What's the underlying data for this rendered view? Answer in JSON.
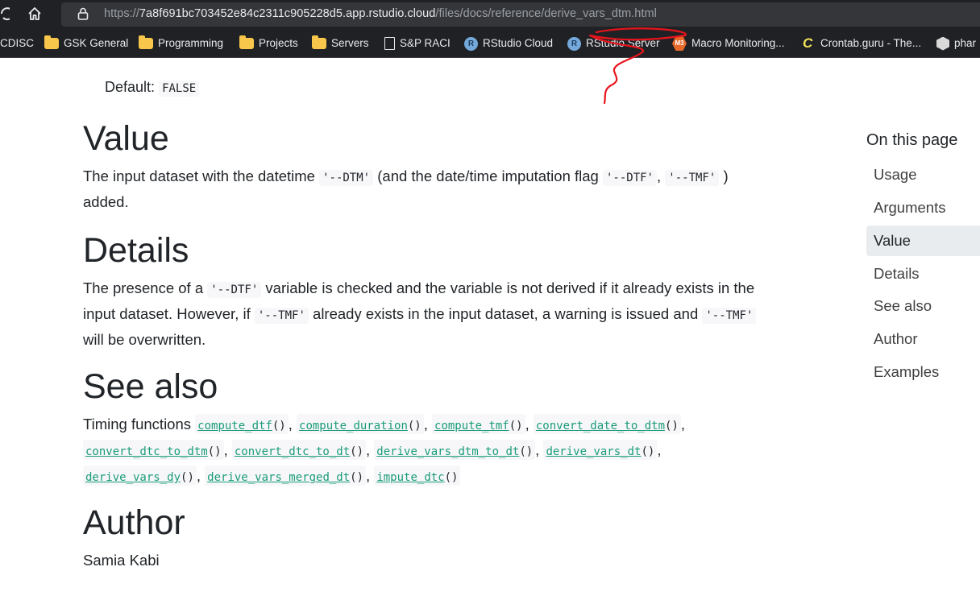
{
  "browser": {
    "url_prefix": "https://",
    "url_host": "7a8f691bc703452e84c2311c905228d5.app.rstudio.cloud",
    "url_path": "/files/docs/reference/derive_vars_dtm.html",
    "bookmarks": [
      {
        "label": "CDISC",
        "icon": "none"
      },
      {
        "label": "GSK General",
        "icon": "folder-icon"
      },
      {
        "label": "Programming",
        "icon": "folder-icon"
      },
      {
        "label": "Projects",
        "icon": "folder-icon"
      },
      {
        "label": "Servers",
        "icon": "folder-icon"
      },
      {
        "label": "S&P RACI",
        "icon": "page-icon"
      },
      {
        "label": "RStudio Cloud",
        "icon": "rstudio-icon"
      },
      {
        "label": "RStudio Server",
        "icon": "rstudio-icon"
      },
      {
        "label": "Macro Monitoring...",
        "icon": "m3-icon"
      },
      {
        "label": "Crontab.guru - The...",
        "icon": "crontab-icon"
      },
      {
        "label": "phar",
        "icon": "hexagon-icon"
      }
    ]
  },
  "doc": {
    "default_label": "Default:",
    "default_value": "FALSE",
    "value": {
      "heading": "Value",
      "text1": "The input dataset with the datetime",
      "code1": "'--DTM'",
      "text2": "(and the date/time imputation flag",
      "code2": "'--DTF'",
      "sep": ",",
      "code3": "'--TMF'",
      "text3": ") added."
    },
    "details": {
      "heading": "Details",
      "text1": "The presence of a",
      "code1": "'--DTF'",
      "text2": "variable is checked and the variable is not derived if it already exists in the input dataset. However, if",
      "code2": "'--TMF'",
      "text3": "already exists in the input dataset, a warning is issued and",
      "code3": "'--TMF'",
      "text4": "will be overwritten."
    },
    "see_also": {
      "heading": "See also",
      "intro": "Timing functions",
      "functions": [
        "compute_dtf",
        "compute_duration",
        "compute_tmf",
        "convert_date_to_dtm",
        "convert_dtc_to_dtm",
        "convert_dtc_to_dt",
        "derive_vars_dtm_to_dt",
        "derive_vars_dt",
        "derive_vars_dy",
        "derive_vars_merged_dt",
        "impute_dtc"
      ],
      "call_suffix": "()"
    },
    "author": {
      "heading": "Author",
      "name": "Samia Kabi"
    }
  },
  "toc": {
    "title": "On this page",
    "items": [
      {
        "label": "Usage",
        "active": false
      },
      {
        "label": "Arguments",
        "active": false
      },
      {
        "label": "Value",
        "active": true
      },
      {
        "label": "Details",
        "active": false
      },
      {
        "label": "See also",
        "active": false
      },
      {
        "label": "Author",
        "active": false
      },
      {
        "label": "Examples",
        "active": false
      }
    ]
  },
  "colors": {
    "link": "#1a9b7a",
    "annotation": "#e8141c",
    "chrome": "#202124"
  }
}
